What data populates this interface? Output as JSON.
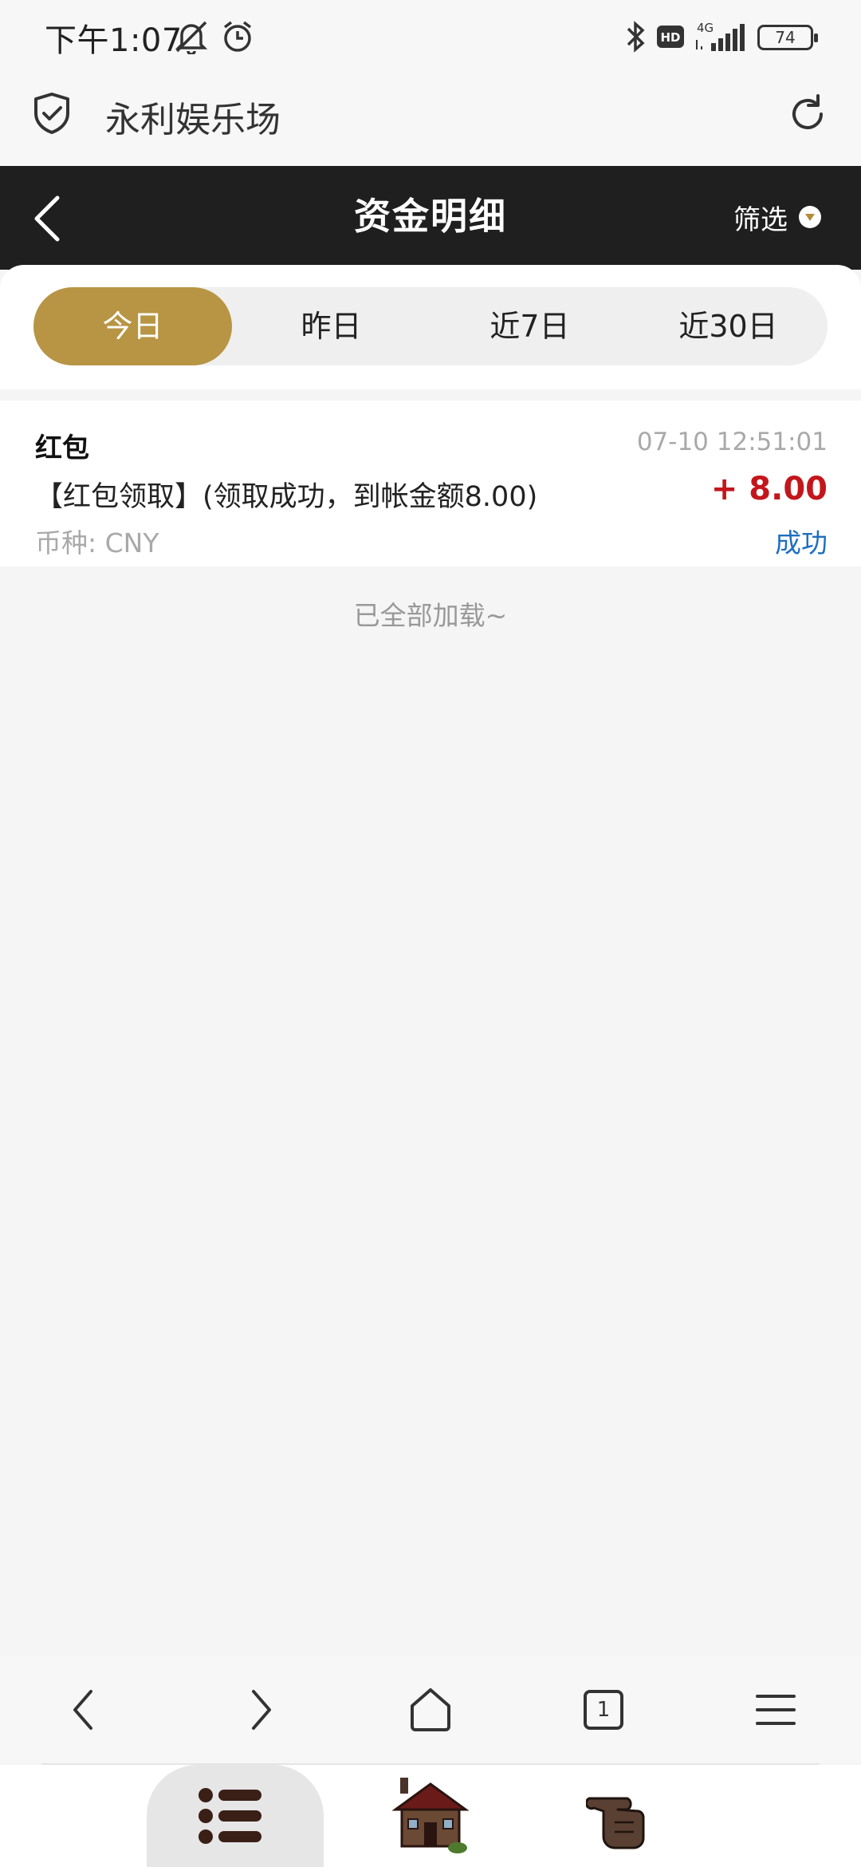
{
  "status_bar": {
    "time": "下午1:07",
    "network": "4G",
    "battery": "74",
    "icons": [
      "bell-muted-icon",
      "alarm-icon",
      "bluetooth-icon",
      "hd-icon",
      "signal-icon",
      "battery-icon"
    ]
  },
  "browser": {
    "site_title": "永利娱乐场",
    "tab_count": "1"
  },
  "header": {
    "title": "资金明细",
    "filter_label": "筛选"
  },
  "tabs": [
    {
      "label": "今日",
      "active": true
    },
    {
      "label": "昨日",
      "active": false
    },
    {
      "label": "近7日",
      "active": false
    },
    {
      "label": "近30日",
      "active": false
    }
  ],
  "records": [
    {
      "title": "红包",
      "time": "07-10 12:51:01",
      "description": "【红包领取】(领取成功，到帐金额8.00)",
      "amount": "+ 8.00",
      "currency": "币种: CNY",
      "status": "成功"
    }
  ],
  "list_end_text": "已全部加载~",
  "colors": {
    "header_bg": "#1f1f1f",
    "accent_gold": "#b89544",
    "amount_red": "#c3161c",
    "status_blue": "#1e6fbf"
  }
}
